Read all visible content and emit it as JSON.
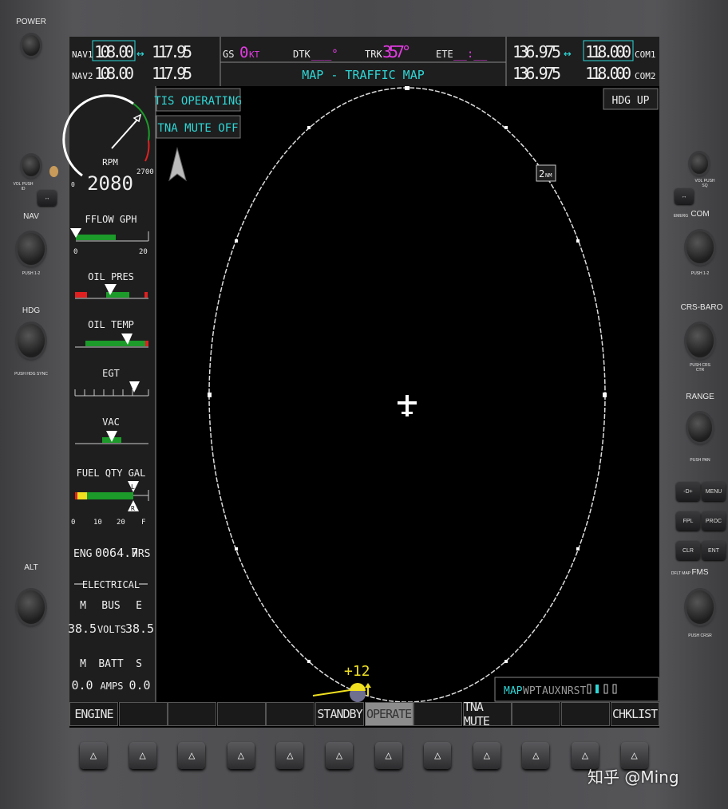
{
  "bezel": {
    "power": "POWER",
    "vol_left": "VOL PUSH ID",
    "nav": "NAV",
    "nav_push": "PUSH 1-2",
    "hdg": "HDG",
    "hdg_push": "PUSH HDG SYNC",
    "alt": "ALT",
    "vol_right": "VOL PUSH SQ",
    "emerg": "EMERG",
    "com": "COM",
    "com_push": "PUSH 1-2",
    "crs_baro": "CRS-BARO",
    "crs_push": "PUSH CRS CTR",
    "range": "RANGE",
    "range_push": "PUSH PAN",
    "keys": {
      "direct": "-D+",
      "menu": "MENU",
      "fpl": "FPL",
      "proc": "PROC",
      "clr": "CLR",
      "ent": "ENT"
    },
    "fms": "FMS",
    "dflt_map": "DFLT MAP",
    "fms_push": "PUSH CRSR"
  },
  "nav": {
    "nav1_label": "NAV1",
    "nav1_active": "108.00",
    "nav1_standby": "117.95",
    "nav2_label": "NAV2",
    "nav2_active": "108.00",
    "nav2_standby": "117.95"
  },
  "com": {
    "com1_label": "COM1",
    "com1_active": "136.975",
    "com1_standby": "118.000",
    "com2_label": "COM2",
    "com2_active": "136.975",
    "com2_standby": "118.000"
  },
  "swap_icon": "↔",
  "nav_data": {
    "gs_label": "GS",
    "gs": "0",
    "gs_unit": "KT",
    "dtk_label": "DTK",
    "dtk": "___°",
    "trk_label": "TRK",
    "trk": "357°",
    "ete_label": "ETE",
    "ete": "__:__"
  },
  "page_title": "MAP - TRAFFIC MAP",
  "engine": {
    "rpm_label": "RPM",
    "rpm": "2080",
    "rpm_min": "0",
    "rpm_max": "2700",
    "rpm_value": 2080,
    "fflow_label": "FFLOW GPH",
    "fflow_min": "0",
    "fflow_max": "20",
    "oil_pres_label": "OIL PRES",
    "oil_temp_label": "OIL TEMP",
    "egt_label": "EGT",
    "vac_label": "VAC",
    "fuel_label": "FUEL QTY GAL",
    "fuel_ticks": [
      "0",
      "10",
      "20",
      "F"
    ],
    "fuel_left": "L",
    "fuel_right": "R",
    "eng_hrs_label": "ENG",
    "eng_hrs": "0064.7",
    "eng_hrs_unit": "HRS",
    "electrical_label": "ELECTRICAL",
    "bus_m": "M",
    "bus_label": "BUS",
    "bus_e": "E",
    "volts_m": "38.5",
    "volts_label": "VOLTS",
    "volts_e": "38.5",
    "batt_m": "M",
    "batt_label": "BATT",
    "batt_s": "S",
    "amps_m": "0.0",
    "amps_label": "AMPS",
    "amps_s": "0.0"
  },
  "map": {
    "tis_status": "TIS OPERATING",
    "tna_status": "TNA MUTE OFF",
    "orientation": "HDG UP",
    "range_ring": "2",
    "range_unit": "NM",
    "traffic_altitude": "+12",
    "north_icon": "north-arrow-icon"
  },
  "page_groups": {
    "items": [
      "MAP",
      "WPT",
      "AUX",
      "NRST"
    ],
    "active": "MAP"
  },
  "softkeys": [
    "ENGINE",
    "",
    "",
    "",
    "",
    "STANDBY",
    "OPERATE",
    "",
    "TNA MUTE",
    "",
    "",
    "CHKLIST"
  ],
  "softkey_active": "OPERATE",
  "colors": {
    "cyan": "#2fd6d6",
    "magenta": "#e23ce2",
    "green": "#1c9a2a",
    "red": "#e02020",
    "yellow": "#f0e020"
  },
  "watermark": "知乎 @Ming"
}
